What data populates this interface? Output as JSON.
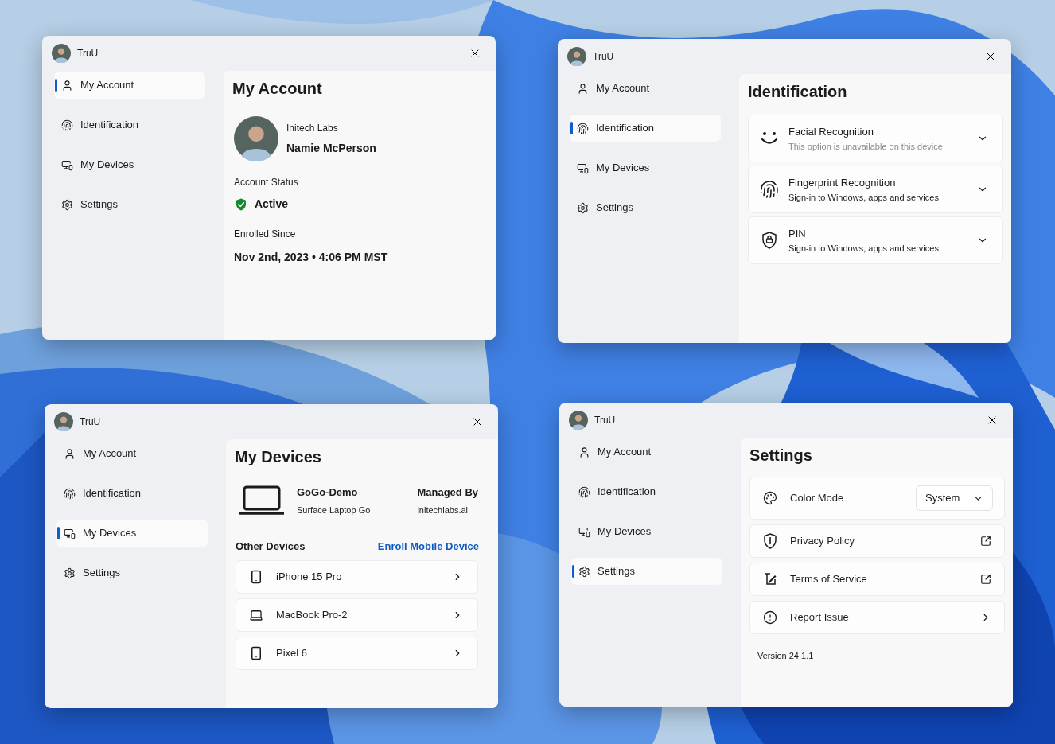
{
  "windows": [
    {
      "app_title": "TruU",
      "nav": [
        {
          "label": "My Account",
          "selected": true
        },
        {
          "label": "Identification",
          "selected": false
        },
        {
          "label": "My Devices",
          "selected": false
        },
        {
          "label": "Settings",
          "selected": false
        }
      ],
      "page": {
        "kind": "account",
        "heading": "My Account",
        "organization": "Initech Labs",
        "user_name": "Namie McPerson",
        "status_label": "Account Status",
        "status": "Active",
        "enrolled_label": "Enrolled Since",
        "enrolled": "Nov 2nd, 2023 • 4:06 PM MST"
      }
    },
    {
      "app_title": "TruU",
      "nav": [
        {
          "label": "My Account",
          "selected": false
        },
        {
          "label": "Identification",
          "selected": true
        },
        {
          "label": "My Devices",
          "selected": false
        },
        {
          "label": "Settings",
          "selected": false
        }
      ],
      "page": {
        "kind": "identification",
        "heading": "Identification",
        "options": [
          {
            "title": "Facial Recognition",
            "subtitle": "This option is unavailable on this device",
            "disabled": true
          },
          {
            "title": "Fingerprint Recognition",
            "subtitle": "Sign-in to Windows, apps and services",
            "disabled": false
          },
          {
            "title": "PIN",
            "subtitle": "Sign-in to Windows, apps and services",
            "disabled": false
          }
        ]
      }
    },
    {
      "app_title": "TruU",
      "nav": [
        {
          "label": "My Account",
          "selected": false
        },
        {
          "label": "Identification",
          "selected": false
        },
        {
          "label": "My Devices",
          "selected": true
        },
        {
          "label": "Settings",
          "selected": false
        }
      ],
      "page": {
        "kind": "devices",
        "heading": "My Devices",
        "current": {
          "name": "GoGo-Demo",
          "model": "Surface Laptop Go",
          "managed_label": "Managed By",
          "managed_by": "initechlabs.ai"
        },
        "other_label": "Other Devices",
        "enroll_link": "Enroll Mobile Device",
        "devices": [
          {
            "name": "iPhone 15 Pro",
            "kind": "phone"
          },
          {
            "name": "MacBook Pro-2",
            "kind": "laptop"
          },
          {
            "name": "Pixel 6",
            "kind": "phone"
          }
        ]
      }
    },
    {
      "app_title": "TruU",
      "nav": [
        {
          "label": "My Account",
          "selected": false
        },
        {
          "label": "Identification",
          "selected": false
        },
        {
          "label": "My Devices",
          "selected": false
        },
        {
          "label": "Settings",
          "selected": true
        }
      ],
      "page": {
        "kind": "settings",
        "heading": "Settings",
        "rows": [
          {
            "label": "Color Mode",
            "kind": "dropdown",
            "value": "System"
          },
          {
            "label": "Privacy Policy",
            "kind": "external"
          },
          {
            "label": "Terms of Service",
            "kind": "external"
          },
          {
            "label": "Report Issue",
            "kind": "chevron"
          }
        ],
        "version": "Version 24.1.1"
      }
    }
  ]
}
